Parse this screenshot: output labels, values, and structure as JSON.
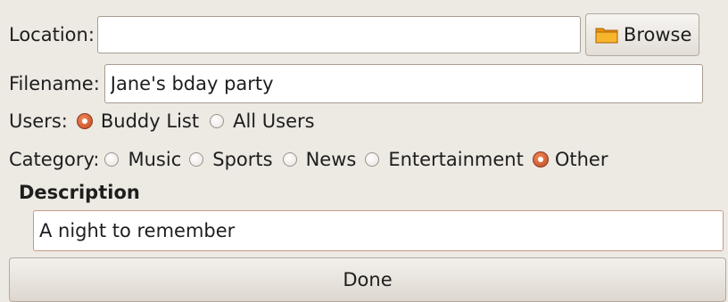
{
  "location": {
    "label": "Location:",
    "value": "",
    "browse_label": "Browse",
    "browse_icon": "folder-icon"
  },
  "filename": {
    "label": "Filename:",
    "value": "Jane's bday party"
  },
  "users": {
    "label": "Users:",
    "options": [
      {
        "label": "Buddy List",
        "checked": true
      },
      {
        "label": "All Users",
        "checked": false
      }
    ]
  },
  "category": {
    "label": "Category:",
    "options": [
      {
        "label": "Music",
        "checked": false
      },
      {
        "label": "Sports",
        "checked": false
      },
      {
        "label": "News",
        "checked": false
      },
      {
        "label": "Entertainment",
        "checked": false
      },
      {
        "label": "Other",
        "checked": true
      }
    ]
  },
  "description": {
    "heading": "Description",
    "value": "A night to remember"
  },
  "done_label": "Done",
  "colors": {
    "window_bg": "#ede9e3",
    "radio_selected": "#d4551f",
    "field_border": "#a79d92",
    "folder": "#f2a516"
  }
}
